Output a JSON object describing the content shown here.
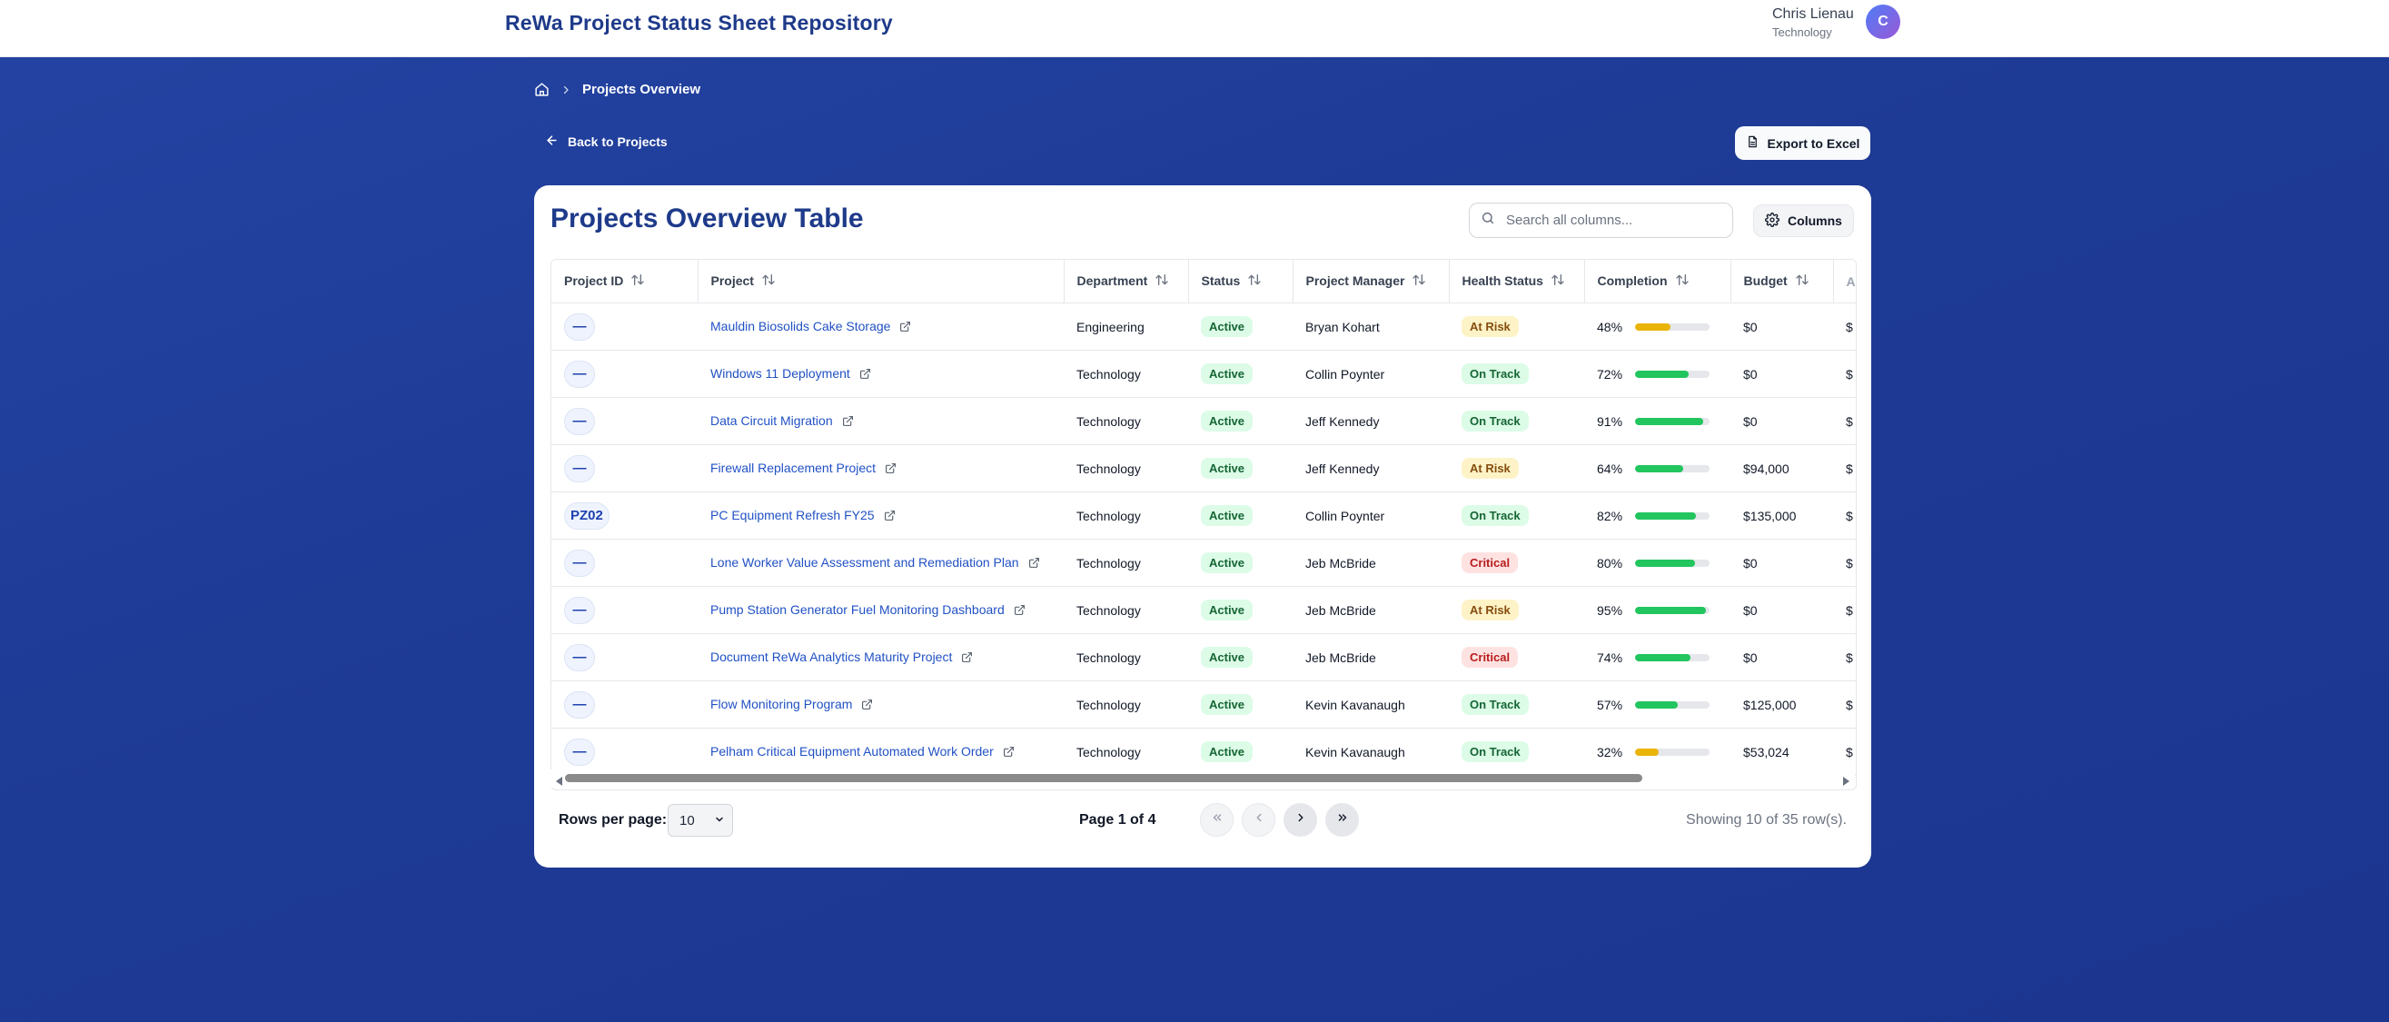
{
  "app": {
    "title": "ReWa Project Status Sheet Repository"
  },
  "user": {
    "name": "Chris Lienau",
    "department": "Technology",
    "initial": "C"
  },
  "breadcrumb": {
    "current": "Projects Overview"
  },
  "back_link": "Back to Projects",
  "export_label": "Export to Excel",
  "card": {
    "title": "Projects Overview Table",
    "search_placeholder": "Search all columns...",
    "columns_label": "Columns"
  },
  "table": {
    "headers": [
      "Project ID",
      "Project",
      "Department",
      "Status",
      "Project Manager",
      "Health Status",
      "Completion",
      "Budget",
      "A"
    ],
    "rows": [
      {
        "id": "—",
        "project": "Mauldin Biosolids Cake Storage",
        "department": "Engineering",
        "status": "Active",
        "manager": "Bryan Kohart",
        "health": "At Risk",
        "completion": "48%",
        "completion_value": 48,
        "budget": "$0",
        "next": "$"
      },
      {
        "id": "—",
        "project": "Windows 11 Deployment",
        "department": "Technology",
        "status": "Active",
        "manager": "Collin Poynter",
        "health": "On Track",
        "completion": "72%",
        "completion_value": 72,
        "budget": "$0",
        "next": "$"
      },
      {
        "id": "—",
        "project": "Data Circuit Migration",
        "department": "Technology",
        "status": "Active",
        "manager": "Jeff Kennedy",
        "health": "On Track",
        "completion": "91%",
        "completion_value": 91,
        "budget": "$0",
        "next": "$"
      },
      {
        "id": "—",
        "project": "Firewall Replacement Project",
        "department": "Technology",
        "status": "Active",
        "manager": "Jeff Kennedy",
        "health": "At Risk",
        "completion": "64%",
        "completion_value": 64,
        "budget": "$94,000",
        "next": "$"
      },
      {
        "id": "PZ02",
        "project": "PC Equipment Refresh FY25",
        "department": "Technology",
        "status": "Active",
        "manager": "Collin Poynter",
        "health": "On Track",
        "completion": "82%",
        "completion_value": 82,
        "budget": "$135,000",
        "next": "$"
      },
      {
        "id": "—",
        "project": "Lone Worker Value Assessment and Remediation Plan",
        "department": "Technology",
        "status": "Active",
        "manager": "Jeb McBride",
        "health": "Critical",
        "completion": "80%",
        "completion_value": 80,
        "budget": "$0",
        "next": "$"
      },
      {
        "id": "—",
        "project": "Pump Station Generator Fuel Monitoring Dashboard",
        "department": "Technology",
        "status": "Active",
        "manager": "Jeb McBride",
        "health": "At Risk",
        "completion": "95%",
        "completion_value": 95,
        "budget": "$0",
        "next": "$"
      },
      {
        "id": "—",
        "project": "Document ReWa Analytics Maturity Project",
        "department": "Technology",
        "status": "Active",
        "manager": "Jeb McBride",
        "health": "Critical",
        "completion": "74%",
        "completion_value": 74,
        "budget": "$0",
        "next": "$"
      },
      {
        "id": "—",
        "project": "Flow Monitoring Program",
        "department": "Technology",
        "status": "Active",
        "manager": "Kevin Kavanaugh",
        "health": "On Track",
        "completion": "57%",
        "completion_value": 57,
        "budget": "$125,000",
        "next": "$"
      },
      {
        "id": "—",
        "project": "Pelham Critical Equipment Automated Work Order",
        "department": "Technology",
        "status": "Active",
        "manager": "Kevin Kavanaugh",
        "health": "On Track",
        "completion": "32%",
        "completion_value": 32,
        "budget": "$53,024",
        "next": "$"
      }
    ]
  },
  "pagination": {
    "rows_per_page_label": "Rows per page:",
    "rows_per_page_value": "10",
    "page_label": "Page 1 of 4",
    "showing": "Showing 10 of 35 row(s)."
  },
  "colors": {
    "background": "#1f3a93",
    "title": "#1e3a8a",
    "link": "#2151c5",
    "progress_green": "#22c55e",
    "progress_amber": "#eab308"
  }
}
